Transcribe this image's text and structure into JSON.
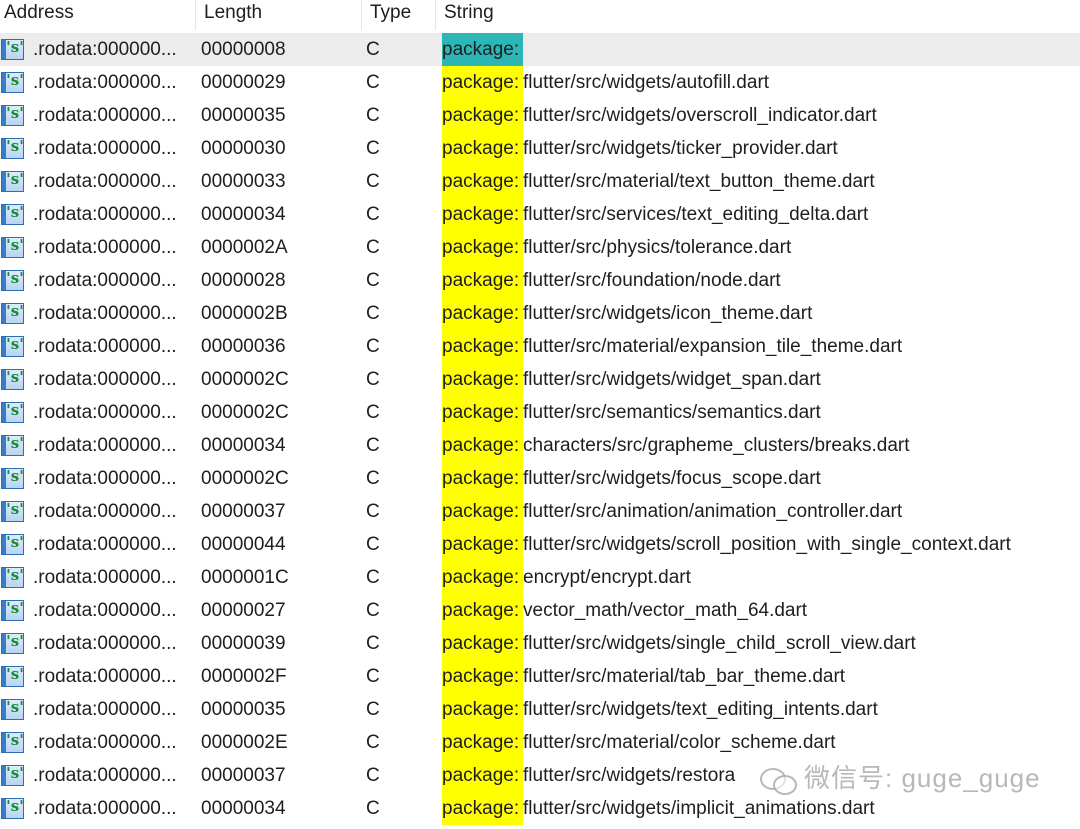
{
  "columns": {
    "address": "Address",
    "length": "Length",
    "type": "Type",
    "string": "String"
  },
  "highlight_colors": {
    "match": "#ffff00",
    "selected_match": "#2cb6b6",
    "selected_row": "#ececec"
  },
  "icon": "string-literal-icon",
  "icon_glyph": "'s'",
  "rows": [
    {
      "address": ".rodata:000000...",
      "length": "00000008",
      "type": "C",
      "prefix": "package:",
      "rest": "",
      "selected": true
    },
    {
      "address": ".rodata:000000...",
      "length": "00000029",
      "type": "C",
      "prefix": "package:",
      "rest": "flutter/src/widgets/autofill.dart"
    },
    {
      "address": ".rodata:000000...",
      "length": "00000035",
      "type": "C",
      "prefix": "package:",
      "rest": "flutter/src/widgets/overscroll_indicator.dart"
    },
    {
      "address": ".rodata:000000...",
      "length": "00000030",
      "type": "C",
      "prefix": "package:",
      "rest": "flutter/src/widgets/ticker_provider.dart"
    },
    {
      "address": ".rodata:000000...",
      "length": "00000033",
      "type": "C",
      "prefix": "package:",
      "rest": "flutter/src/material/text_button_theme.dart"
    },
    {
      "address": ".rodata:000000...",
      "length": "00000034",
      "type": "C",
      "prefix": "package:",
      "rest": "flutter/src/services/text_editing_delta.dart"
    },
    {
      "address": ".rodata:000000...",
      "length": "0000002A",
      "type": "C",
      "prefix": "package:",
      "rest": "flutter/src/physics/tolerance.dart"
    },
    {
      "address": ".rodata:000000...",
      "length": "00000028",
      "type": "C",
      "prefix": "package:",
      "rest": "flutter/src/foundation/node.dart"
    },
    {
      "address": ".rodata:000000...",
      "length": "0000002B",
      "type": "C",
      "prefix": "package:",
      "rest": "flutter/src/widgets/icon_theme.dart"
    },
    {
      "address": ".rodata:000000...",
      "length": "00000036",
      "type": "C",
      "prefix": "package:",
      "rest": "flutter/src/material/expansion_tile_theme.dart"
    },
    {
      "address": ".rodata:000000...",
      "length": "0000002C",
      "type": "C",
      "prefix": "package:",
      "rest": "flutter/src/widgets/widget_span.dart"
    },
    {
      "address": ".rodata:000000...",
      "length": "0000002C",
      "type": "C",
      "prefix": "package:",
      "rest": "flutter/src/semantics/semantics.dart"
    },
    {
      "address": ".rodata:000000...",
      "length": "00000034",
      "type": "C",
      "prefix": "package:",
      "rest": "characters/src/grapheme_clusters/breaks.dart"
    },
    {
      "address": ".rodata:000000...",
      "length": "0000002C",
      "type": "C",
      "prefix": "package:",
      "rest": "flutter/src/widgets/focus_scope.dart"
    },
    {
      "address": ".rodata:000000...",
      "length": "00000037",
      "type": "C",
      "prefix": "package:",
      "rest": "flutter/src/animation/animation_controller.dart"
    },
    {
      "address": ".rodata:000000...",
      "length": "00000044",
      "type": "C",
      "prefix": "package:",
      "rest": "flutter/src/widgets/scroll_position_with_single_context.dart"
    },
    {
      "address": ".rodata:000000...",
      "length": "0000001C",
      "type": "C",
      "prefix": "package:",
      "rest": "encrypt/encrypt.dart"
    },
    {
      "address": ".rodata:000000...",
      "length": "00000027",
      "type": "C",
      "prefix": "package:",
      "rest": "vector_math/vector_math_64.dart"
    },
    {
      "address": ".rodata:000000...",
      "length": "00000039",
      "type": "C",
      "prefix": "package:",
      "rest": "flutter/src/widgets/single_child_scroll_view.dart"
    },
    {
      "address": ".rodata:000000...",
      "length": "0000002F",
      "type": "C",
      "prefix": "package:",
      "rest": "flutter/src/material/tab_bar_theme.dart"
    },
    {
      "address": ".rodata:000000...",
      "length": "00000035",
      "type": "C",
      "prefix": "package:",
      "rest": "flutter/src/widgets/text_editing_intents.dart"
    },
    {
      "address": ".rodata:000000...",
      "length": "0000002E",
      "type": "C",
      "prefix": "package:",
      "rest": "flutter/src/material/color_scheme.dart"
    },
    {
      "address": ".rodata:000000...",
      "length": "00000037",
      "type": "C",
      "prefix": "package:",
      "rest": "flutter/src/widgets/restora"
    },
    {
      "address": ".rodata:000000...",
      "length": "00000034",
      "type": "C",
      "prefix": "package:",
      "rest": "flutter/src/widgets/implicit_animations.dart"
    }
  ],
  "watermark": {
    "icon": "wechat-icon",
    "text": "微信号: guge_guge"
  }
}
